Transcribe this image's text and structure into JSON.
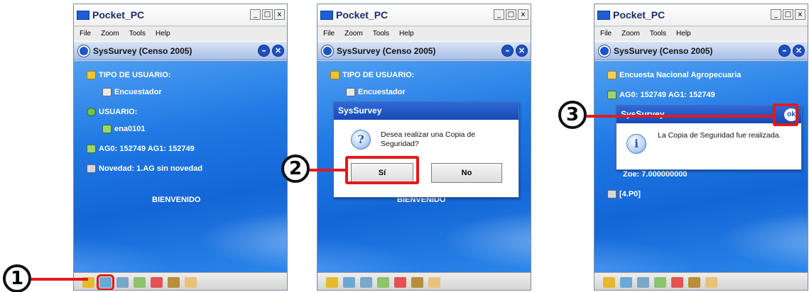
{
  "window": {
    "title": "Pocket_PC",
    "min": "_",
    "max": "□",
    "close": "x"
  },
  "menu": {
    "file": "File",
    "zoom": "Zoom",
    "tools": "Tools",
    "help": "Help"
  },
  "app": {
    "title": "SysSurvey (Censo 2005)",
    "min_icon": "minimize-icon",
    "close_icon": "close-icon"
  },
  "screen1": {
    "tipo_label": "TIPO DE USUARIO:",
    "tipo_value": "Encuestador",
    "usuario_label": "USUARIO:",
    "usuario_value": "ena0101",
    "ag_line": "AG0: 152749     AG1: 152749",
    "novedad": "Novedad: 1.AG sin novedad",
    "bienvenido": "BIENVENIDO"
  },
  "screen2": {
    "tipo_label": "TIPO DE USUARIO:",
    "tipo_value": "Encuestador",
    "bienvenido": "BIENVENIDO",
    "dialog_title": "SysSurvey",
    "dialog_icon": "?",
    "dialog_message": "Desea realizar una Copia de Seguridad?",
    "yes": "Sí",
    "no": "No"
  },
  "screen3": {
    "encuesta": "Encuesta Nacional Agropecuaria",
    "ag_line": "AG0: 152749    AG1: 152749",
    "dialog_title": "SysSurvey",
    "ok": "ok",
    "dialog_icon": "i",
    "dialog_message": "La Copia de Seguridad fue realizada.",
    "zoe_line": "Zoe:  7.000000000",
    "p0": "[4.P0]"
  },
  "callouts": [
    "1",
    "2",
    "3"
  ],
  "toolbar_icons": [
    "user-icon",
    "people-icon",
    "database-icon",
    "sync-icon",
    "flag-icon",
    "pen-icon",
    "triangle-icon"
  ],
  "colors": {
    "highlight": "#e11a1a",
    "screen_blue": "#1f78e4",
    "dialog_title": "#1849b3"
  }
}
